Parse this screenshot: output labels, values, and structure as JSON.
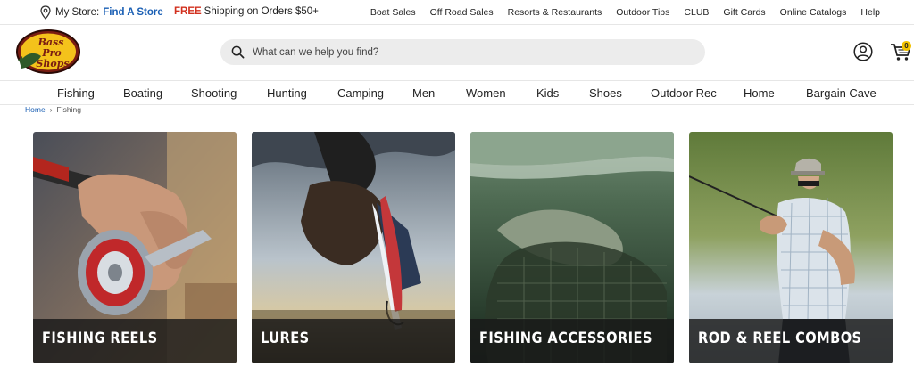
{
  "topbar": {
    "store_label": "My Store:",
    "store_link": "Find A Store",
    "promo_free": "FREE",
    "promo_text": "Shipping on Orders $50+",
    "links": [
      "Boat Sales",
      "Off Road Sales",
      "Resorts & Restaurants",
      "Outdoor Tips",
      "CLUB",
      "Gift Cards",
      "Online Catalogs",
      "Help"
    ]
  },
  "header": {
    "logo_text": "Bass Pro Shops",
    "search_placeholder": "What can we help you find?",
    "cart_count": "0"
  },
  "catnav": {
    "items": [
      "Fishing",
      "Boating",
      "Shooting",
      "Hunting",
      "Camping",
      "Men",
      "Women",
      "Kids",
      "Shoes",
      "Outdoor Rec",
      "Home",
      "Bargain Cave"
    ]
  },
  "breadcrumb": {
    "home": "Home",
    "separator": "›",
    "current": "Fishing"
  },
  "tiles": [
    {
      "label": "FISHING REELS"
    },
    {
      "label": "LURES"
    },
    {
      "label": "FISHING ACCESSORIES"
    },
    {
      "label": "ROD & REEL COMBOS"
    }
  ],
  "colors": {
    "brand_red": "#d2311f",
    "link_blue": "#1a5fb4",
    "cart_badge": "#f2c200",
    "caption_bg": "#191919"
  }
}
